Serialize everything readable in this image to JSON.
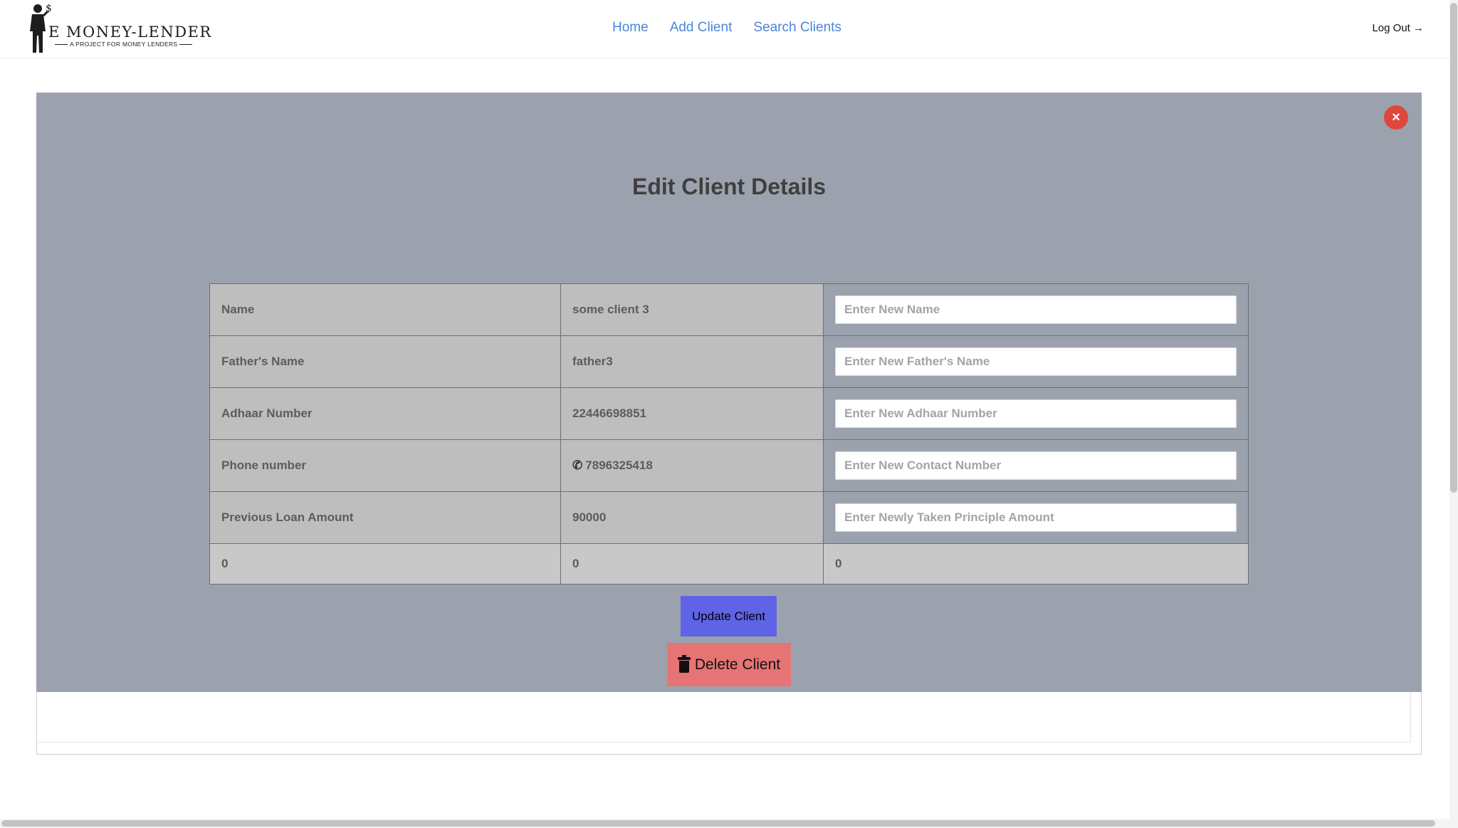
{
  "header": {
    "logo": {
      "title": "E MONEY-LENDER",
      "subtitle": "A PROJECT FOR MONEY LENDERS"
    },
    "nav": [
      {
        "label": "Home"
      },
      {
        "label": "Add Client"
      },
      {
        "label": "Search Clients"
      }
    ],
    "logout_label": "Log Out →"
  },
  "modal": {
    "close_icon": "×",
    "title": "Edit Client Details",
    "rows": [
      {
        "label": "Name",
        "value": "some client 3",
        "placeholder": "Enter New Name"
      },
      {
        "label": "Father's Name",
        "value": "father3",
        "placeholder": "Enter New Father's Name"
      },
      {
        "label": "Adhaar Number",
        "value": "22446698851",
        "placeholder": "Enter New Adhaar Number"
      },
      {
        "label": "Phone number",
        "value": "7896325418",
        "placeholder": "Enter New Contact Number",
        "icon": "phone-icon"
      },
      {
        "label": "Previous Loan Amount",
        "value": "90000",
        "placeholder": "Enter Newly Taken Principle Amount"
      }
    ],
    "footer_row": [
      "0",
      "0",
      "0"
    ],
    "update_label": "Update Client",
    "delete_label": "Delete Client"
  },
  "colors": {
    "nav_link": "#4a86d8",
    "modal_bg": "#9ca2ad",
    "close_button": "#e0473c",
    "update_button": "#5f63e6",
    "delete_button": "#e67474"
  }
}
